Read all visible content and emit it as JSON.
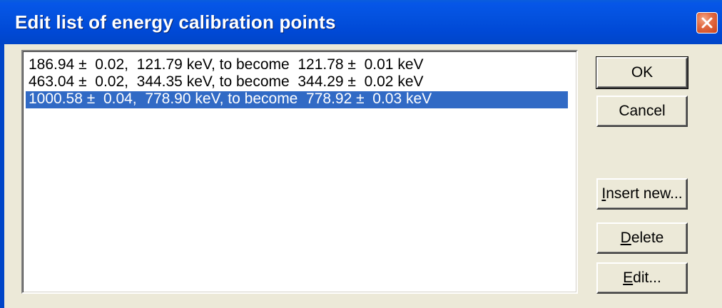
{
  "window": {
    "title": "Edit list of energy calibration points"
  },
  "list": {
    "items": [
      {
        "text": "186.94 ±  0.02,  121.79 keV, to become  121.78 ±  0.01 keV",
        "selected": false
      },
      {
        "text": "463.04 ±  0.02,  344.35 keV, to become  344.29 ±  0.02 keV",
        "selected": false
      },
      {
        "text": "1000.58 ±  0.04,  778.90 keV, to become  778.92 ±  0.03 keV",
        "selected": true
      }
    ]
  },
  "buttons": {
    "ok": "OK",
    "cancel": "Cancel",
    "insert_mnemonic": "I",
    "insert_rest": "nsert new...",
    "delete_mnemonic": "D",
    "delete_rest": "elete",
    "edit_mnemonic": "E",
    "edit_rest": "dit..."
  },
  "colors": {
    "titlebar": "#0351de",
    "selection": "#316ac5",
    "face": "#ece9d8",
    "close": "#e36d44"
  },
  "icons": {
    "close": "close-icon"
  }
}
